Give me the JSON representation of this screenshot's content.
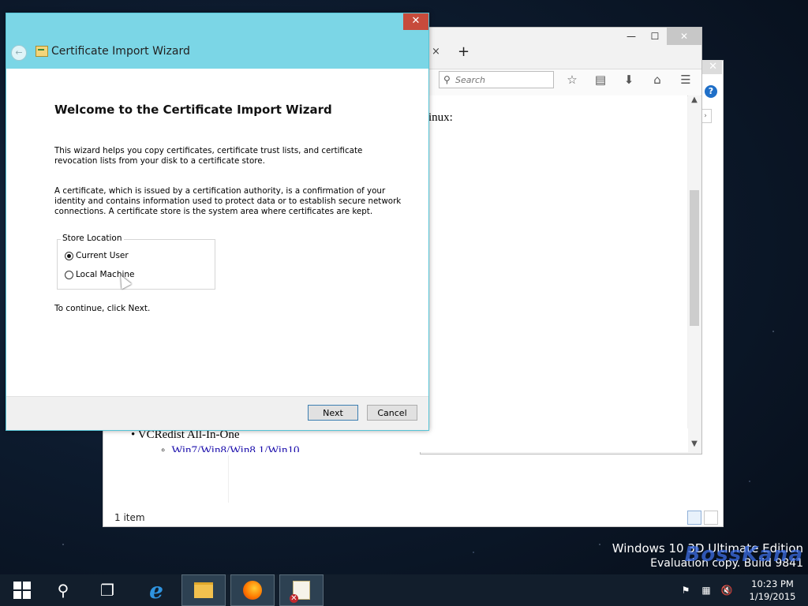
{
  "watermark": {
    "edition": "Windows 10 3D Ultimate Edition",
    "brand": "BossKana",
    "build": "Evaluation copy. Build 9841"
  },
  "explorer": {
    "status": "1 item",
    "help": "?"
  },
  "browser": {
    "tab_close": "×",
    "new_tab": "+",
    "window_buttons": {
      "minimize": "—",
      "maximize": "☐",
      "close": "✕"
    },
    "search": {
      "placeholder": "Search",
      "value": ""
    },
    "page_fragment": "inux:",
    "vcredist_item": "VCRedist All-In-One",
    "vcredist_link": "Win7/Win8/Win8.1/Win10"
  },
  "dialog": {
    "title": "Certificate Import Wizard",
    "close": "✕",
    "heading": "Welcome to the Certificate Import Wizard",
    "paragraph1": "This wizard helps you copy certificates, certificate trust lists, and certificate revocation lists from your disk to a certificate store.",
    "paragraph2": "A certificate, which is issued by a certification authority, is a confirmation of your identity and contains information used to protect data or to establish secure network connections. A certificate store is the system area where certificates are kept.",
    "store_location": {
      "legend": "Store Location",
      "options": [
        {
          "label": "Current User",
          "selected": true
        },
        {
          "label": "Local Machine",
          "selected": false
        }
      ]
    },
    "continue_text": "To continue, click Next.",
    "buttons": {
      "next": "Next",
      "cancel": "Cancel"
    }
  },
  "taskbar": {
    "items": [
      "start",
      "search",
      "task-view",
      "internet-explorer",
      "file-explorer",
      "firefox",
      "certificate-manager"
    ],
    "clock": {
      "time": "10:23 PM",
      "date": "1/19/2015"
    }
  }
}
